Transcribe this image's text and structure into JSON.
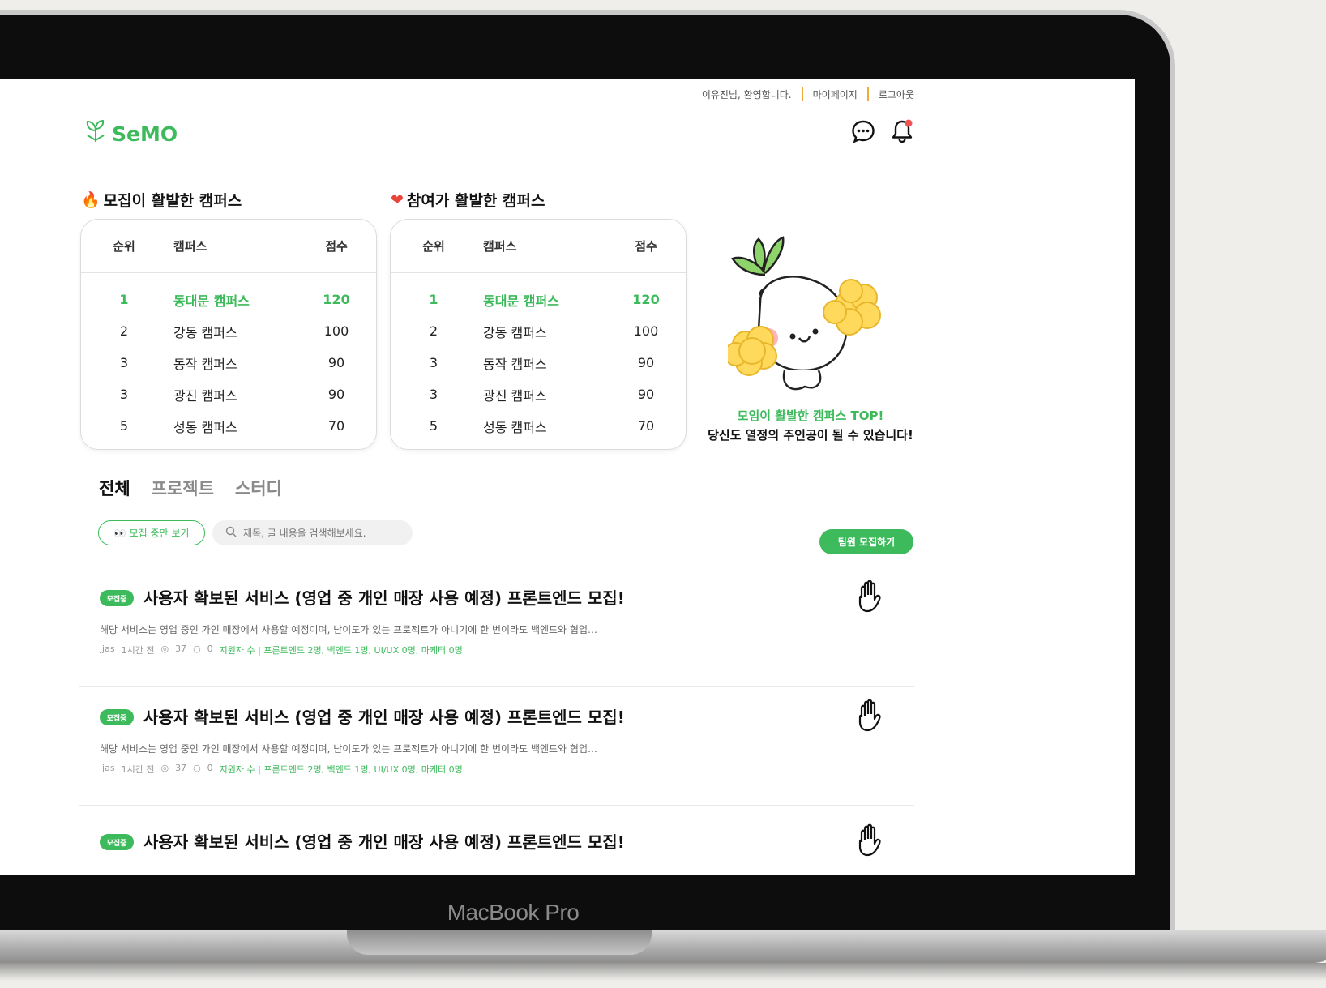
{
  "device": {
    "label": "MacBook Pro"
  },
  "topnav": {
    "greeting": "이유진님, 환영합니다.",
    "mypage": "마이페이지",
    "logout": "로그아웃"
  },
  "logo": {
    "text": "SeMO"
  },
  "rankings": [
    {
      "title": "모집이 활발한 캠퍼스",
      "emoji": "🔥",
      "headers": [
        "순위",
        "캠퍼스",
        "점수"
      ],
      "rows": [
        {
          "rank": "1",
          "campus": "동대문 캠퍼스",
          "score": "120"
        },
        {
          "rank": "2",
          "campus": "강동 캠퍼스",
          "score": "100"
        },
        {
          "rank": "3",
          "campus": "동작 캠퍼스",
          "score": "90"
        },
        {
          "rank": "3",
          "campus": "광진 캠퍼스",
          "score": "90"
        },
        {
          "rank": "5",
          "campus": "성동 캠퍼스",
          "score": "70"
        }
      ]
    },
    {
      "title": "참여가 활발한 캠퍼스",
      "emoji": "❤",
      "headers": [
        "순위",
        "캠퍼스",
        "점수"
      ],
      "rows": [
        {
          "rank": "1",
          "campus": "동대문 캠퍼스",
          "score": "120"
        },
        {
          "rank": "2",
          "campus": "강동 캠퍼스",
          "score": "100"
        },
        {
          "rank": "3",
          "campus": "동작 캠퍼스",
          "score": "90"
        },
        {
          "rank": "3",
          "campus": "광진 캠퍼스",
          "score": "90"
        },
        {
          "rank": "5",
          "campus": "성동 캠퍼스",
          "score": "70"
        }
      ]
    }
  ],
  "promo": {
    "line1": "모임이 활발한 캠퍼스 TOP!",
    "line2": "당신도 열정의 주인공이 될 수 있습니다!"
  },
  "tabs": [
    {
      "label": "전체"
    },
    {
      "label": "프로젝트"
    },
    {
      "label": "스터디"
    }
  ],
  "filter": {
    "label": "모집 중만 보기"
  },
  "search": {
    "placeholder": "제목, 글 내용을 검색해보세요."
  },
  "recruit_button": {
    "label": "팀원 모집하기"
  },
  "posts": [
    {
      "badge": "모집중",
      "title": "사용자 확보된 서비스 (영업 중 개인 매장 사용 예정) 프론트엔드 모집!",
      "desc": "해당 서비스는 영업 중인 가인 매장에서 사용할 예정이며, 난이도가 있는 프로젝트가 아니기에 한 번이라도 백엔드와 협업…",
      "author": "jjas",
      "time": "1시간 전",
      "views": "37",
      "comments": "0",
      "applicants": "지원자 수 | 프론트엔드 2명, 백엔드 1명, UI/UX 0명, 마케터 0명"
    },
    {
      "badge": "모집중",
      "title": "사용자 확보된 서비스 (영업 중 개인 매장 사용 예정) 프론트엔드 모집!",
      "desc": "해당 서비스는 영업 중인 가인 매장에서 사용할 예정이며, 난이도가 있는 프로젝트가 아니기에 한 번이라도 백엔드와 협업…",
      "author": "jjas",
      "time": "1시간 전",
      "views": "37",
      "comments": "0",
      "applicants": "지원자 수 | 프론트엔드 2명, 백엔드 1명, UI/UX 0명, 마케터 0명"
    },
    {
      "badge": "모집중",
      "title": "사용자 확보된 서비스 (영업 중 개인 매장 사용 예정) 프론트엔드 모집!",
      "desc": "",
      "author": "",
      "time": "",
      "views": "",
      "comments": "",
      "applicants": ""
    }
  ],
  "colors": {
    "brand": "#3dba5b",
    "divider_accent": "#f0a93a"
  }
}
